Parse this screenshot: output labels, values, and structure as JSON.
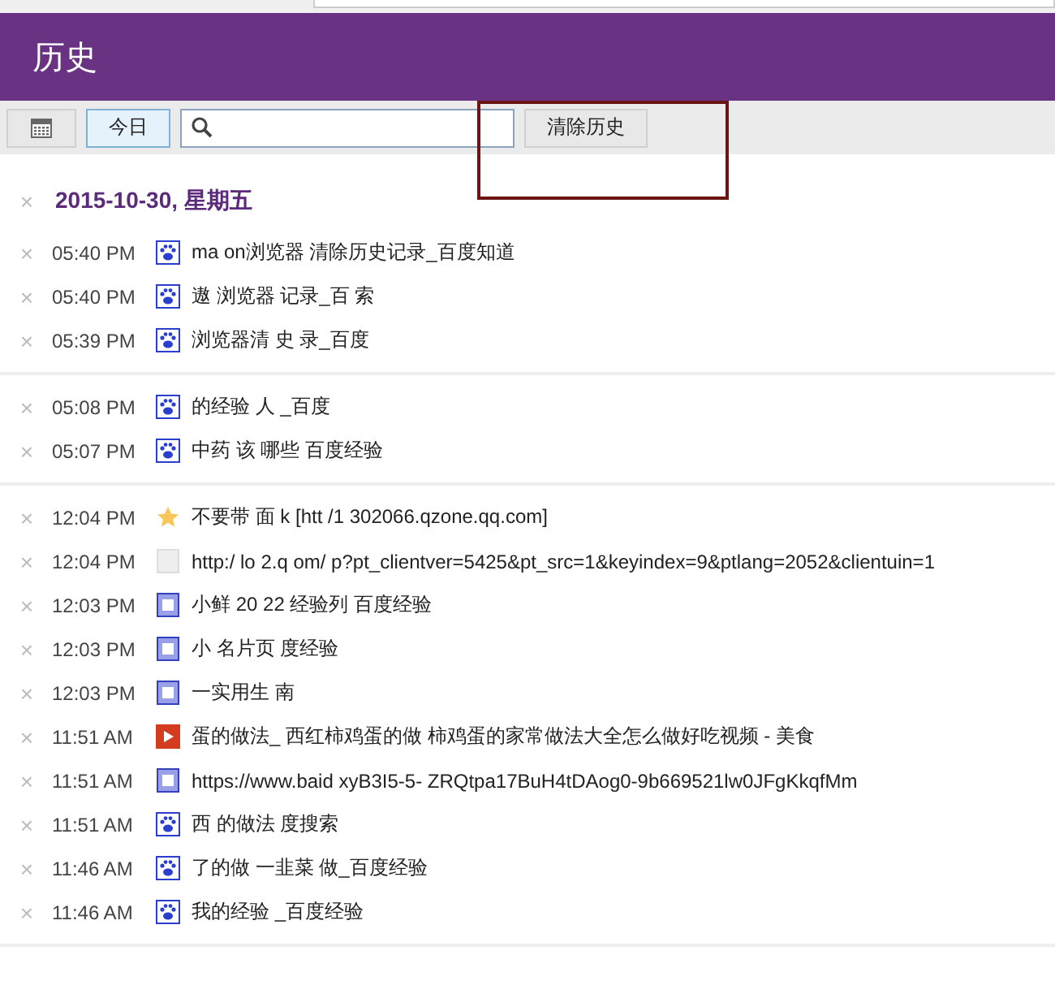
{
  "header": {
    "title": "历史"
  },
  "toolbar": {
    "today_button": {
      "label": "今日",
      "selected": true
    },
    "clear_button": {
      "label": "清除历史"
    }
  },
  "day": {
    "heading": "2015-10-30, 星期五",
    "close": "×"
  },
  "groups": [
    {
      "entries": [
        {
          "close": "×",
          "time": "05:40 PM",
          "kind": "paw",
          "title": "ma on浏览器 清除历史记录_百度知道"
        },
        {
          "close": "×",
          "time": "05:40 PM",
          "kind": "paw",
          "title": "遨 浏览器 记录_百 索"
        },
        {
          "close": "×",
          "time": "05:39 PM",
          "kind": "paw",
          "title": "浏览器清 史 录_百度"
        }
      ]
    },
    {
      "entries": [
        {
          "close": "×",
          "time": "05:08 PM",
          "kind": "paw",
          "title": "的经验 人 _百度"
        },
        {
          "close": "×",
          "time": "05:07 PM",
          "kind": "paw",
          "title": "中药 该 哪些 百度经验"
        }
      ]
    },
    {
      "entries": [
        {
          "close": "×",
          "time": "12:04 PM",
          "kind": "star",
          "title": "不要带 面 k [htt /1 302066.qzone.qq.com]"
        },
        {
          "close": "×",
          "time": "12:04 PM",
          "kind": "blank",
          "title": "http:/ lo 2.q om/ p?pt_clientver=5425&pt_src=1&keyindex=9&ptlang=2052&clientuin=1"
        },
        {
          "close": "×",
          "time": "12:03 PM",
          "kind": "page",
          "title": "小鲜 20 22 经验列 百度经验"
        },
        {
          "close": "×",
          "time": "12:03 PM",
          "kind": "page",
          "title": "小 名片页 度经验"
        },
        {
          "close": "×",
          "time": "12:03 PM",
          "kind": "page",
          "title": "一实用生 南"
        },
        {
          "close": "×",
          "time": "11:51 AM",
          "kind": "video",
          "title": "蛋的做法_ 西红柿鸡蛋的做 柿鸡蛋的家常做法大全怎么做好吃视频 - 美食"
        },
        {
          "close": "×",
          "time": "11:51 AM",
          "kind": "page",
          "title": "https://www.baid xyB3I5-5- ZRQtpa17BuH4tDAog0-9b669521lw0JFgKkqfMm"
        },
        {
          "close": "×",
          "time": "11:51 AM",
          "kind": "paw",
          "title": "西 的做法 度搜索"
        },
        {
          "close": "×",
          "time": "11:46 AM",
          "kind": "paw",
          "title": "了的做 一韭菜 做_百度经验"
        },
        {
          "close": "×",
          "time": "11:46 AM",
          "kind": "paw",
          "title": "我的经验 _百度经验"
        }
      ]
    }
  ]
}
